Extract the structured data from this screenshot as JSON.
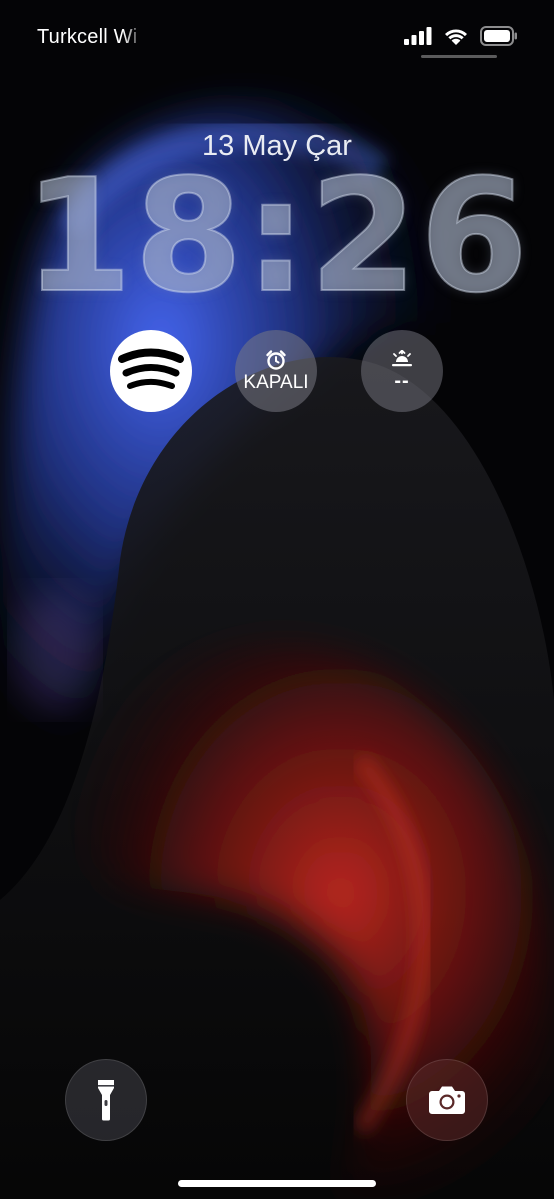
{
  "status_bar": {
    "carrier": "Turkcell Wi",
    "signal_icon": "cellular-signal-icon",
    "wifi_icon": "wifi-icon",
    "battery_icon": "battery-icon"
  },
  "lock_screen": {
    "date": "13 May Çar",
    "time": "18:26"
  },
  "widgets": {
    "spotify": {
      "icon": "spotify-icon"
    },
    "alarm": {
      "icon": "alarm-clock-icon",
      "label": "KAPALI"
    },
    "sunrise": {
      "icon": "sunrise-icon",
      "value": "--"
    }
  },
  "bottom_actions": {
    "flashlight": {
      "icon": "flashlight-icon"
    },
    "camera": {
      "icon": "camera-icon"
    }
  },
  "colors": {
    "background": "#050507",
    "blue_wave": "#3a5bd6",
    "red_wave": "#b5231c",
    "clock_fill": "#afb9cd"
  }
}
